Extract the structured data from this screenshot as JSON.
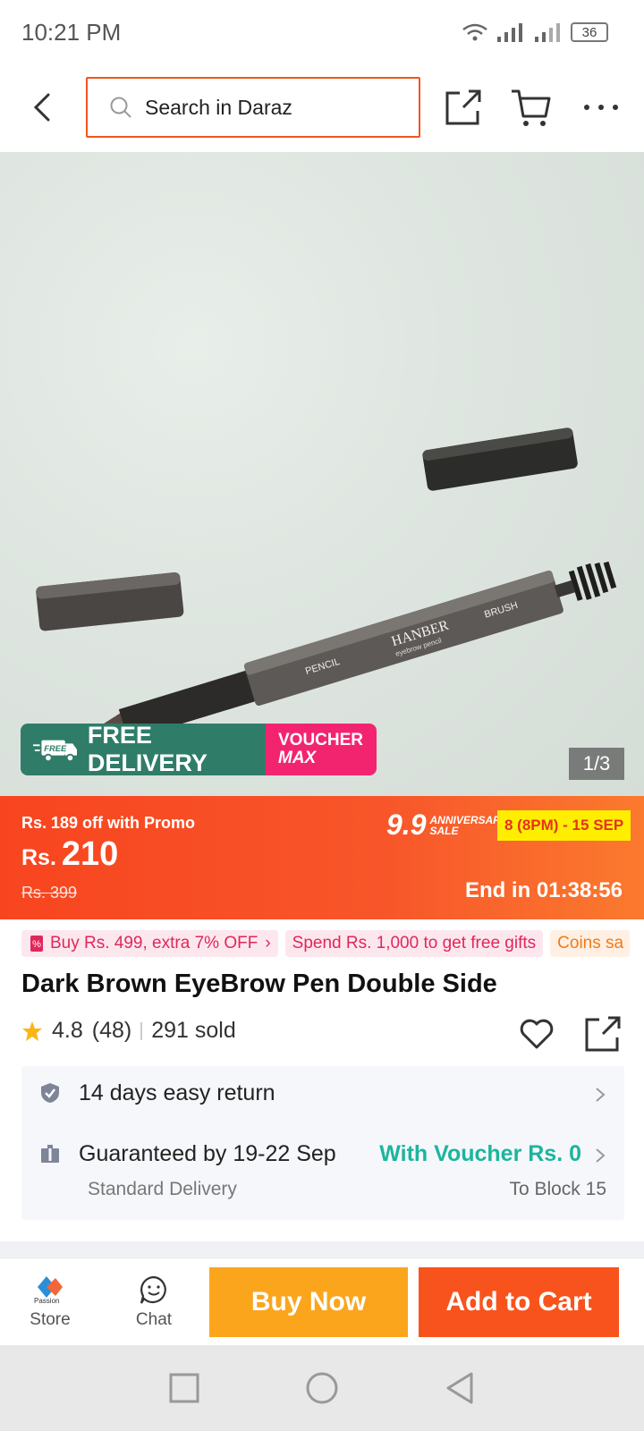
{
  "status_bar": {
    "time": "10:21 PM",
    "battery": "36"
  },
  "search": {
    "placeholder": "Search in Daraz"
  },
  "product_image": {
    "counter": "1/3",
    "brand_text": "HANBER",
    "sub_text": "eyebrow pencil",
    "pencil_label": "PENCIL",
    "brush_label": "BRUSH"
  },
  "badges": {
    "free_tag": "FREE",
    "free_delivery": "FREE DELIVERY",
    "voucher_line1": "VOUCHER",
    "voucher_line2": "MAX"
  },
  "price": {
    "promo": "Rs. 189 off with Promo",
    "currency": "Rs.",
    "amount": "210",
    "old_price": "Rs. 399",
    "sale_big": "9.9",
    "sale_small_1": "ANNIVERSARY",
    "sale_small_2": "SALE",
    "sale_date": "8 (8PM) - 15 SEP",
    "countdown": "End in 01:38:56"
  },
  "tags": [
    {
      "label": "Buy Rs. 499, extra 7% OFF"
    },
    {
      "label": "Spend Rs. 1,000 to get free gifts"
    },
    {
      "label": "Coins sa"
    }
  ],
  "product": {
    "title": "Dark Brown EyeBrow Pen Double Side",
    "rating": "4.8",
    "reviews": "(48)",
    "sold": "291 sold"
  },
  "services": {
    "return": "14 days easy return",
    "delivery": "Guaranteed by 19-22 Sep",
    "delivery_sub": "Standard Delivery",
    "voucher": "With Voucher Rs. 0",
    "location": "To Block 15"
  },
  "bottom_bar": {
    "store": "Store",
    "store_logo_text": "Passion",
    "chat": "Chat",
    "buy_now": "Buy Now",
    "add_to_cart": "Add to Cart"
  },
  "colors": {
    "accent": "#f8531d",
    "buy_now": "#fba51d",
    "voucher_green": "#1bb59d"
  }
}
